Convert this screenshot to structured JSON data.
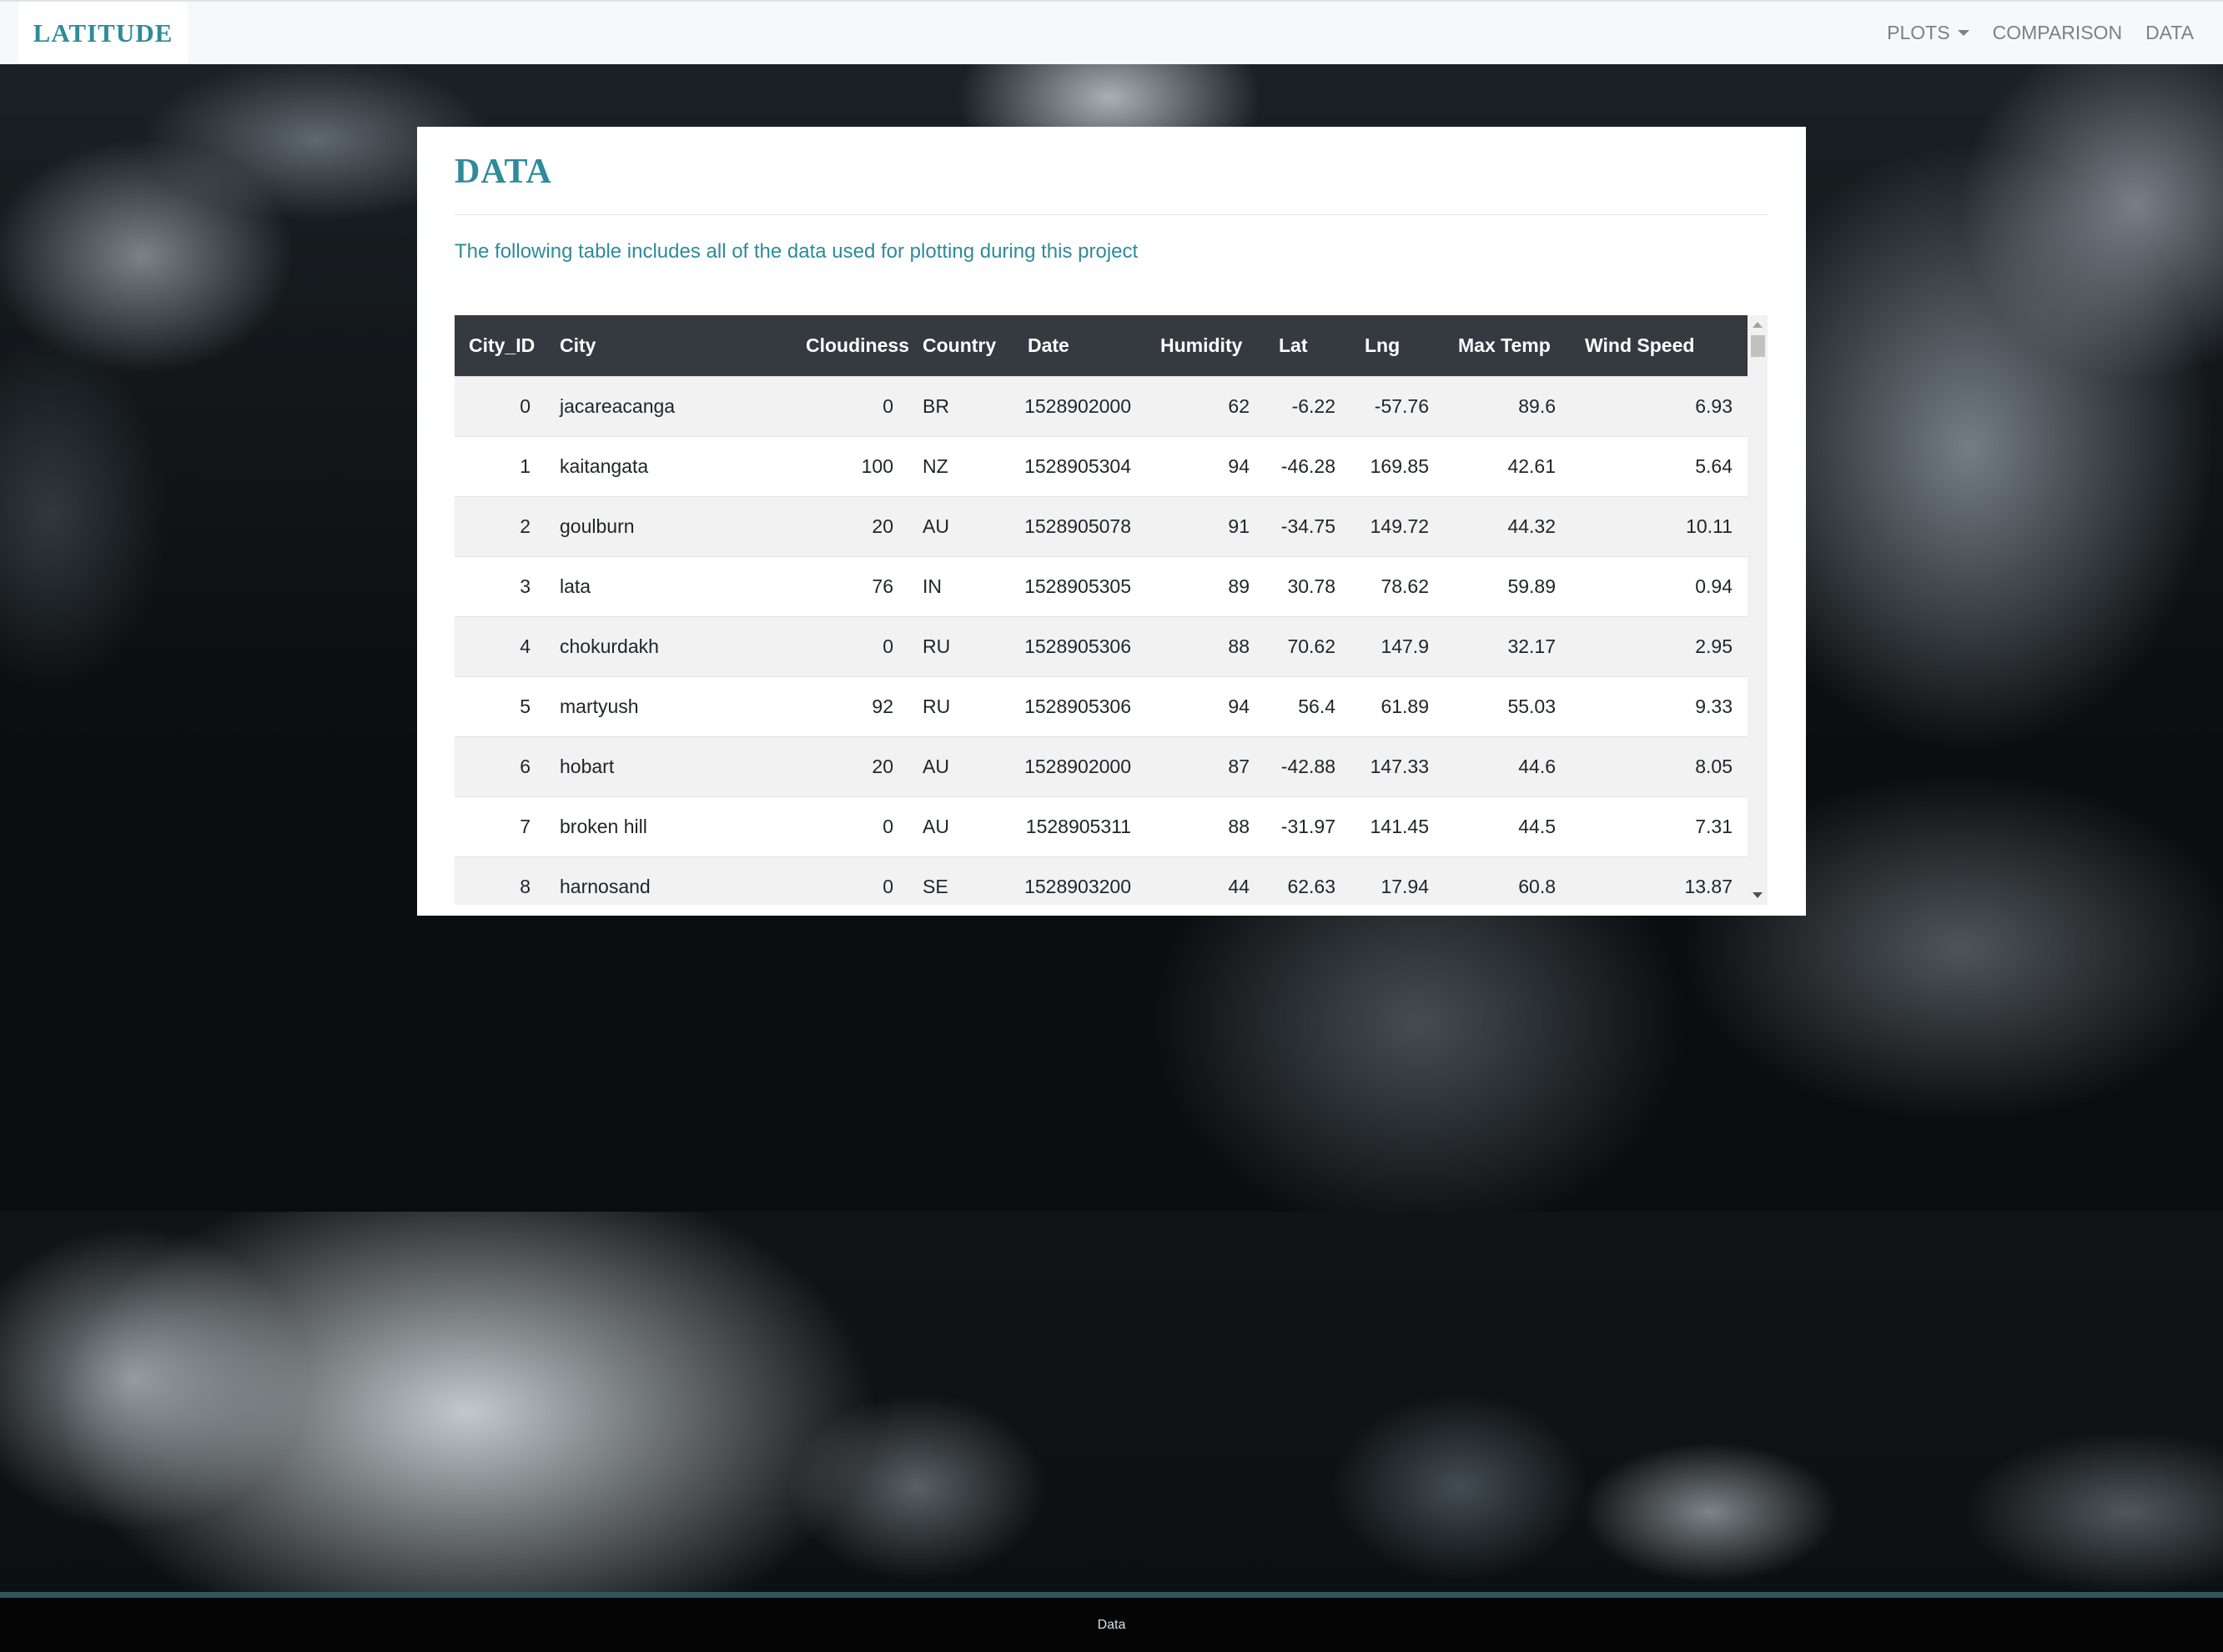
{
  "navbar": {
    "brand": "LATITUDE",
    "links": {
      "plots": "PLOTS",
      "comparison": "COMPARISON",
      "data": "DATA"
    }
  },
  "card": {
    "title": "DATA",
    "description": "The following table includes all of the data used for plotting during this project"
  },
  "table": {
    "columns": [
      "City_ID",
      "City",
      "Cloudiness",
      "Country",
      "Date",
      "Humidity",
      "Lat",
      "Lng",
      "Max Temp",
      "Wind Speed"
    ],
    "rows": [
      [
        "0",
        "jacareacanga",
        "0",
        "BR",
        "1528902000",
        "62",
        "-6.22",
        "-57.76",
        "89.6",
        "6.93"
      ],
      [
        "1",
        "kaitangata",
        "100",
        "NZ",
        "1528905304",
        "94",
        "-46.28",
        "169.85",
        "42.61",
        "5.64"
      ],
      [
        "2",
        "goulburn",
        "20",
        "AU",
        "1528905078",
        "91",
        "-34.75",
        "149.72",
        "44.32",
        "10.11"
      ],
      [
        "3",
        "lata",
        "76",
        "IN",
        "1528905305",
        "89",
        "30.78",
        "78.62",
        "59.89",
        "0.94"
      ],
      [
        "4",
        "chokurdakh",
        "0",
        "RU",
        "1528905306",
        "88",
        "70.62",
        "147.9",
        "32.17",
        "2.95"
      ],
      [
        "5",
        "martyush",
        "92",
        "RU",
        "1528905306",
        "94",
        "56.4",
        "61.89",
        "55.03",
        "9.33"
      ],
      [
        "6",
        "hobart",
        "20",
        "AU",
        "1528902000",
        "87",
        "-42.88",
        "147.33",
        "44.6",
        "8.05"
      ],
      [
        "7",
        "broken hill",
        "0",
        "AU",
        "1528905311",
        "88",
        "-31.97",
        "141.45",
        "44.5",
        "7.31"
      ],
      [
        "8",
        "harnosand",
        "0",
        "SE",
        "1528903200",
        "44",
        "62.63",
        "17.94",
        "60.8",
        "13.87"
      ]
    ]
  },
  "footer": {
    "text": "Data"
  },
  "colors": {
    "accent": "#2e8b99",
    "table_header": "#343a40"
  }
}
